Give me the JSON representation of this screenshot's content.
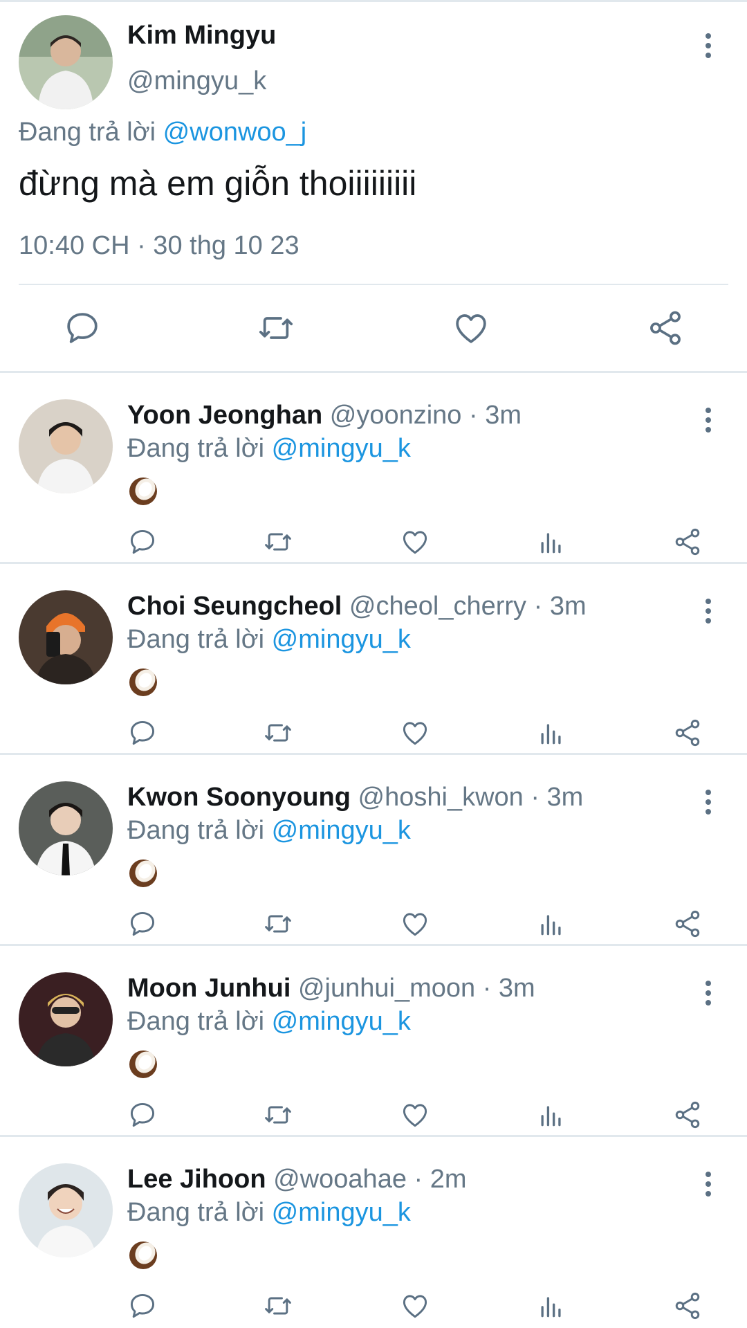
{
  "main_tweet": {
    "display_name": "Kim Mingyu",
    "handle": "@mingyu_k",
    "replying_prefix": "Đang trả lời",
    "replying_to": "@wonwoo_j",
    "text": "đừng mà em giỗn thoiiiiiiiii",
    "timestamp": "10:40 CH · 30 thg 10 23"
  },
  "replies": [
    {
      "display_name": "Yoon Jeonghan",
      "handle": "@yoonzino",
      "time": " · 3m",
      "replying_prefix": "Đang trả lời",
      "replying_to": "@mingyu_k",
      "emoji": "coconut"
    },
    {
      "display_name": "Choi Seungcheol",
      "handle": "@cheol_cherry",
      "time": " · 3m",
      "replying_prefix": "Đang trả lời",
      "replying_to": "@mingyu_k",
      "emoji": "coconut"
    },
    {
      "display_name": "Kwon Soonyoung",
      "handle": "@hoshi_kwon",
      "time": " · 3m",
      "replying_prefix": "Đang trả lời",
      "replying_to": "@mingyu_k",
      "emoji": "coconut"
    },
    {
      "display_name": "Moon Junhui",
      "handle": "@junhui_moon",
      "time": " · 3m",
      "replying_prefix": "Đang trả lời",
      "replying_to": "@mingyu_k",
      "emoji": "coconut"
    },
    {
      "display_name": "Lee Jihoon",
      "handle": "@wooahae",
      "time": " · 2m",
      "replying_prefix": "Đang trả lời",
      "replying_to": "@mingyu_k",
      "emoji": "coconut"
    }
  ],
  "icons": {
    "actions_main": [
      "reply-icon",
      "retweet-icon",
      "like-icon",
      "share-icon"
    ],
    "actions_reply": [
      "reply-icon",
      "retweet-icon",
      "like-icon",
      "analytics-icon",
      "share-icon"
    ],
    "menu": "more-vertical-icon"
  },
  "colors": {
    "link": "#1b95e0",
    "secondary": "#657786",
    "icon": "#5b7083",
    "divider": "#e1e8ed"
  }
}
